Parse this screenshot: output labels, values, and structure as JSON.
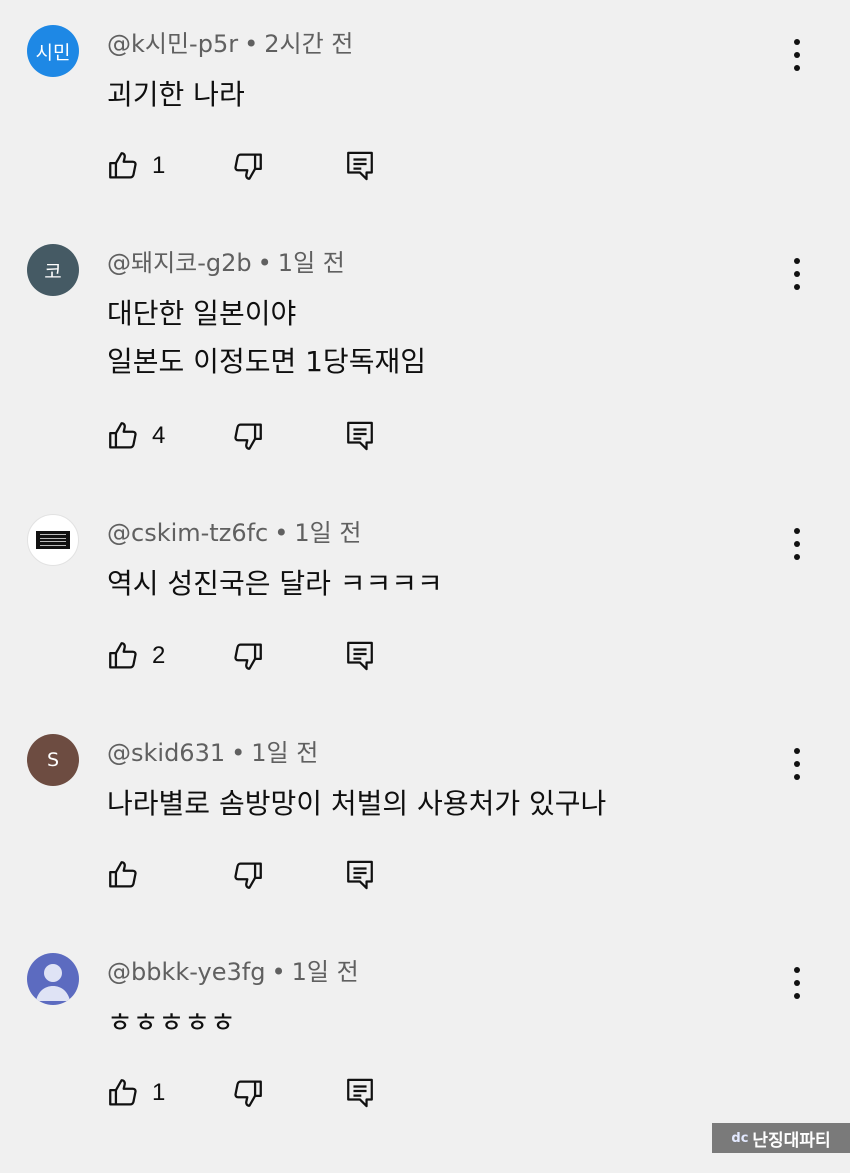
{
  "comments": [
    {
      "avatar": {
        "text": "시민",
        "color": "#1e88e5"
      },
      "handle": "@k시민-p5r",
      "time": "2시간 전",
      "lines": [
        "괴기한 나라"
      ],
      "likes": "1"
    },
    {
      "avatar": {
        "text": "코",
        "color": "#455a64"
      },
      "handle": "@돼지코-g2b",
      "time": "1일 전",
      "lines": [
        "대단한 일본이야",
        "일본도 이정도면 1당독재임"
      ],
      "likes": "4"
    },
    {
      "avatar": {
        "text": "",
        "color": "#ffffff"
      },
      "handle": "@cskim-tz6fc",
      "time": "1일 전",
      "lines": [
        "역시 성진국은 달라 ㅋㅋㅋㅋ"
      ],
      "likes": "2"
    },
    {
      "avatar": {
        "text": "S",
        "color": "#6d4c41"
      },
      "handle": "@skid631",
      "time": "1일 전",
      "lines": [
        "나라별로 솜방망이 처벌의 사용처가 있구나"
      ],
      "likes": ""
    },
    {
      "avatar": {
        "text": "",
        "color": "#5c6bc0"
      },
      "handle": "@bbkk-ye3fg",
      "time": "1일 전",
      "lines": [
        "ㅎㅎㅎㅎㅎ"
      ],
      "likes": "1"
    }
  ],
  "separator": "•",
  "icons": {
    "like": "thumbs-up-icon",
    "dislike": "thumbs-down-icon",
    "reply": "reply-comment-icon",
    "more": "more-vert-icon"
  },
  "watermark": {
    "logo": "dc",
    "text": "난징대파티"
  }
}
